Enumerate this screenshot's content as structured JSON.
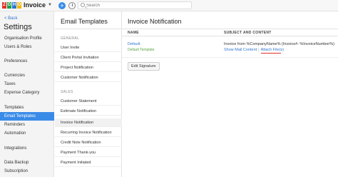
{
  "app": {
    "logo_letters": [
      "Z",
      "O",
      "H",
      "O"
    ],
    "logo_colors": [
      "#e4322b",
      "#1b9f4a",
      "#2a76d2",
      "#f4b400"
    ],
    "name": "Invoice",
    "search_placeholder": "Search",
    "accent": "#3a8be8"
  },
  "sidebar": {
    "back": "< Back",
    "title": "Settings",
    "items": [
      {
        "label": "Organisation Profile"
      },
      {
        "label": "Users & Roles"
      },
      {
        "label": "Preferences"
      },
      {
        "label": "Currencies"
      },
      {
        "label": "Taxes"
      },
      {
        "label": "Expense Category"
      },
      {
        "label": "Templates"
      },
      {
        "label": "Email Templates"
      },
      {
        "label": "Reminders"
      },
      {
        "label": "Automation"
      },
      {
        "label": "Integrations"
      },
      {
        "label": "Data Backup"
      },
      {
        "label": "Subscription"
      }
    ]
  },
  "templates": {
    "title": "Email Templates",
    "general_label": "GENERAL",
    "general_items": [
      {
        "label": "User Invite"
      },
      {
        "label": "Client Portal Invitation"
      },
      {
        "label": "Project Notification"
      },
      {
        "label": "Customer Notification"
      }
    ],
    "sales_label": "SALES",
    "sales_items": [
      {
        "label": "Customer Statement"
      },
      {
        "label": "Estimate Notification"
      },
      {
        "label": "Invoice Notification"
      },
      {
        "label": "Recurring Invoice Notification"
      },
      {
        "label": "Credit Note Notification"
      },
      {
        "label": "Payment Thank-you"
      },
      {
        "label": "Payment Initiated"
      }
    ]
  },
  "main": {
    "title": "Invoice Notification",
    "col_name": "NAME",
    "col_subject": "SUBJECT AND CONTENT",
    "row": {
      "name": "Default",
      "badge": "Default Template",
      "subject": "Invoice from %CompanyName% (Invoice#: %InvoiceNumber%)",
      "show_mail": "Show Mail Content",
      "separator": "|",
      "attach": "Attach File(s)"
    },
    "edit_signature": "Edit Signature"
  }
}
